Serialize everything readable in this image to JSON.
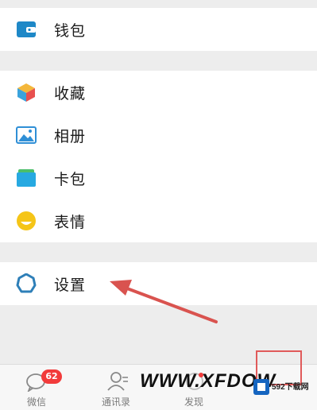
{
  "menu": {
    "wallet": "钱包",
    "favorites": "收藏",
    "album": "相册",
    "cards": "卡包",
    "stickers": "表情",
    "settings": "设置"
  },
  "tabbar": {
    "chats": "微信",
    "chats_badge": "62",
    "contacts": "通讯录",
    "discover": "发现"
  },
  "watermark": {
    "text": "WWW.XFDOW",
    "site": "592下载网"
  },
  "colors": {
    "arrow": "#d9534f",
    "badge": "#f23b3b",
    "settings_icon": "#2e7fb8"
  }
}
